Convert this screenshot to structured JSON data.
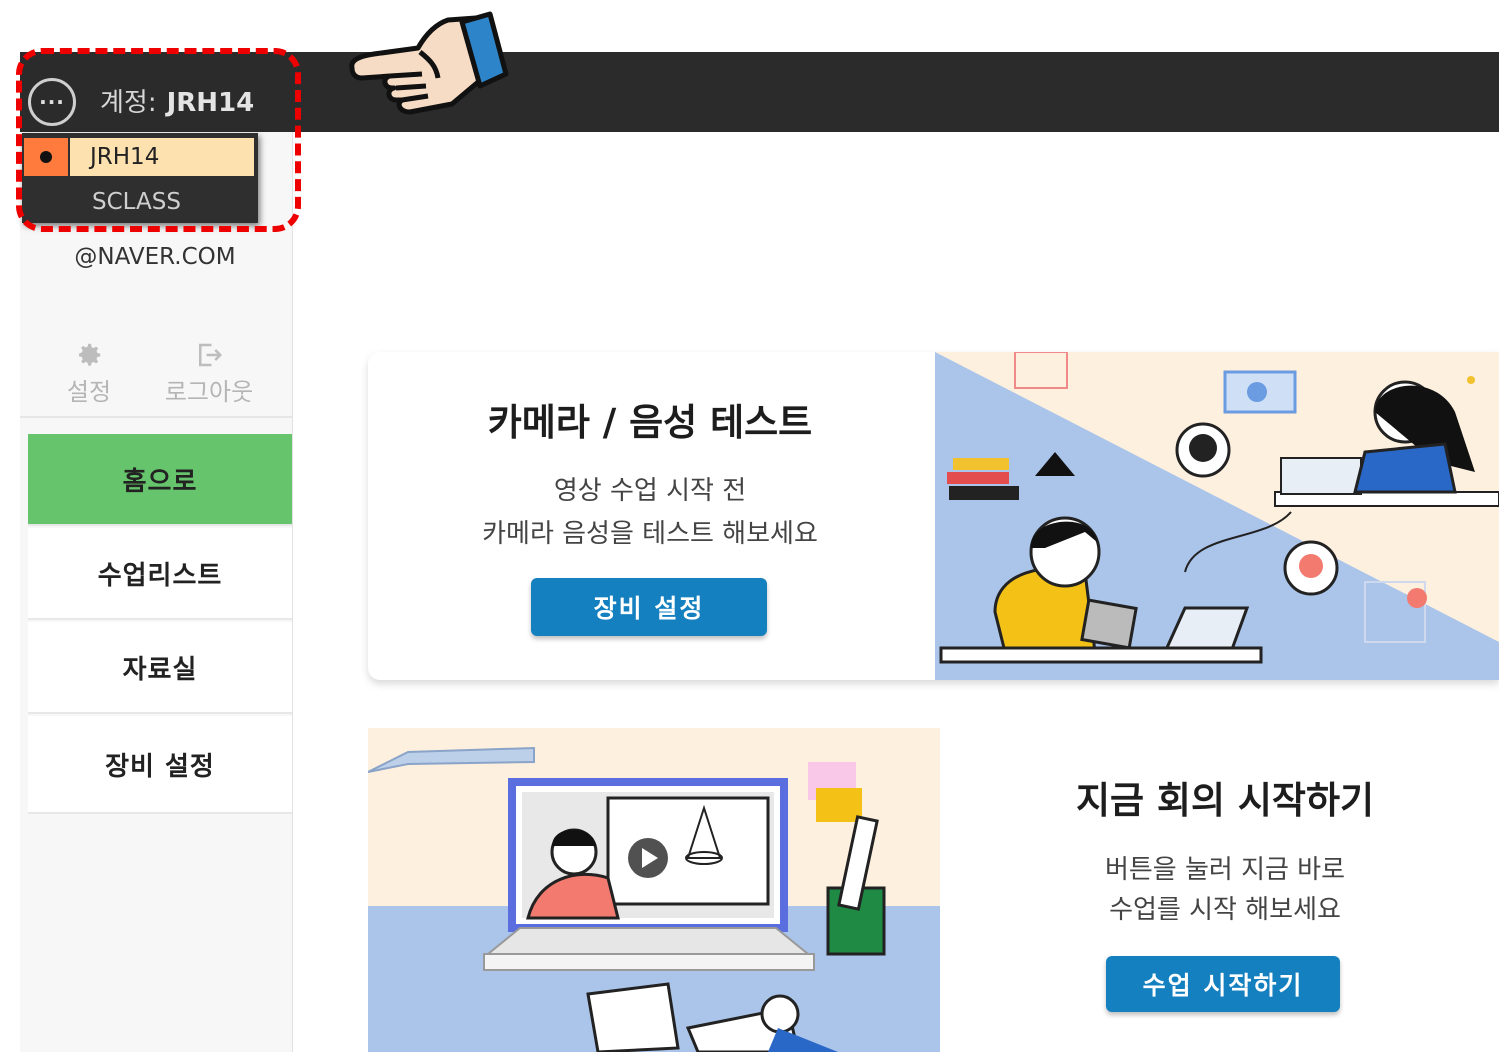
{
  "header": {
    "account_prefix": "계정:",
    "account_name": "JRH14",
    "menu_icon_glyph": "···"
  },
  "account_dropdown": {
    "items": [
      {
        "label": "JRH14",
        "selected": true
      },
      {
        "label": "SCLASS",
        "selected": false
      }
    ]
  },
  "sidebar": {
    "email": "@NAVER.COM",
    "actions": [
      {
        "label": "설정",
        "icon": "gear-icon"
      },
      {
        "label": "로그아웃",
        "icon": "logout-icon"
      }
    ],
    "menu": [
      {
        "label": "홈으로",
        "active": true
      },
      {
        "label": "수업리스트",
        "active": false
      },
      {
        "label": "자료실",
        "active": false
      },
      {
        "label": "장비 설정",
        "active": false
      }
    ]
  },
  "cards": {
    "camera_test": {
      "title": "카메라 / 음성 테스트",
      "desc_line1": "영상 수업 시작 전",
      "desc_line2": "카메라 음성을 테스트 해보세요",
      "button": "장비 설정"
    },
    "start_meeting": {
      "title": "지금 회의 시작하기",
      "desc_line1": "버튼을 눌러 지금 바로",
      "desc_line2": "수업를 시작 해보세요",
      "button": "수업 시작하기"
    }
  },
  "colors": {
    "topbar": "#2b2b2b",
    "active_menu": "#66c46c",
    "primary_button": "#1480c0",
    "highlight": "#ee0000",
    "selected_item_bg": "#fde2b0",
    "selected_marker": "#ff7a3d"
  }
}
